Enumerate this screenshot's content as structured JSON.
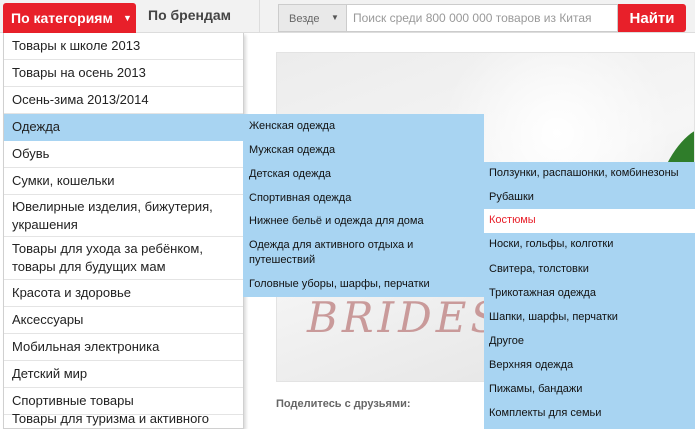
{
  "header": {
    "category_tab": "По категориям",
    "category_tab_icon": "chevron-down-icon",
    "brand_tab": "По брендам",
    "scope_label": "Везде",
    "scope_icon": "caret-down-icon",
    "search_placeholder": "Поиск среди 800 000 000 товаров из Китая",
    "search_button": "Найти"
  },
  "colors": {
    "accent": "#e8202a",
    "menu_highlight": "#a8d4f2"
  },
  "categories": [
    "Товары к школе 2013",
    "Товары на осень 2013",
    "Осень-зима 2013/2014",
    "Одежда",
    "Обувь",
    "Сумки, кошельки",
    "Ювелирные изделия, бижутерия, украшения",
    "Товары для ухода за ребёнком, товары для будущих мам",
    "Красота и здоровье",
    "Аксессуары",
    "Мобильная электроника",
    "Детский мир",
    "Спортивные товары",
    "Товары для туризма и активного отдыха"
  ],
  "active_category": "Одежда",
  "submenu": [
    "Женская одежда",
    "Мужская одежда",
    "Детская одежда",
    "Спортивная одежда",
    "Нижнее бельё и одежда для дома",
    "Одежда для активного отдыха и путешествий",
    "Головные уборы, шарфы, перчатки"
  ],
  "subsubmenu": [
    "Ползунки, распашонки, комбинезоны",
    "Рубашки",
    "Костюмы",
    "Носки, гольфы, колготки",
    "Свитера, толстовки",
    "Трикотажная одежда",
    "Шапки, шарфы, перчатки",
    "Другое",
    "Верхняя одежда",
    "Пижамы, бандажи",
    "Комплекты для семьи"
  ],
  "active_subsubmenu": "Костюмы",
  "banner_text": "BRIDES",
  "share_label": "Поделитесь с друзьями:"
}
